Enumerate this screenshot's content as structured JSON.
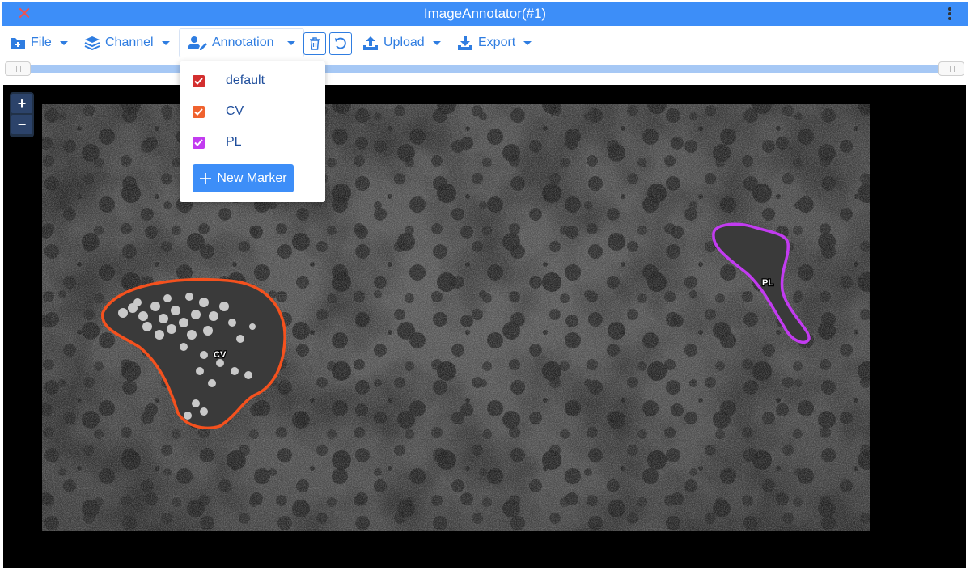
{
  "window": {
    "title": "ImageAnnotator(#1)"
  },
  "toolbar": {
    "file_label": "File",
    "channel_label": "Channel",
    "annotation_label": "Annotation",
    "upload_label": "Upload",
    "export_label": "Export"
  },
  "slider": {
    "range": [
      0,
      1
    ]
  },
  "annotation_menu": {
    "markers": [
      {
        "label": "default",
        "color": "#d32f2f",
        "checked": true
      },
      {
        "label": "CV",
        "color": "#f0622e",
        "checked": true
      },
      {
        "label": "PL",
        "color": "#c23bf0",
        "checked": true
      }
    ],
    "new_marker_label": "New Marker"
  },
  "viewer": {
    "zoom_in": "+",
    "zoom_out": "−",
    "annotations": [
      {
        "label": "CV",
        "color": "#f4511e"
      },
      {
        "label": "PL",
        "color": "#c23bf0"
      }
    ]
  }
}
